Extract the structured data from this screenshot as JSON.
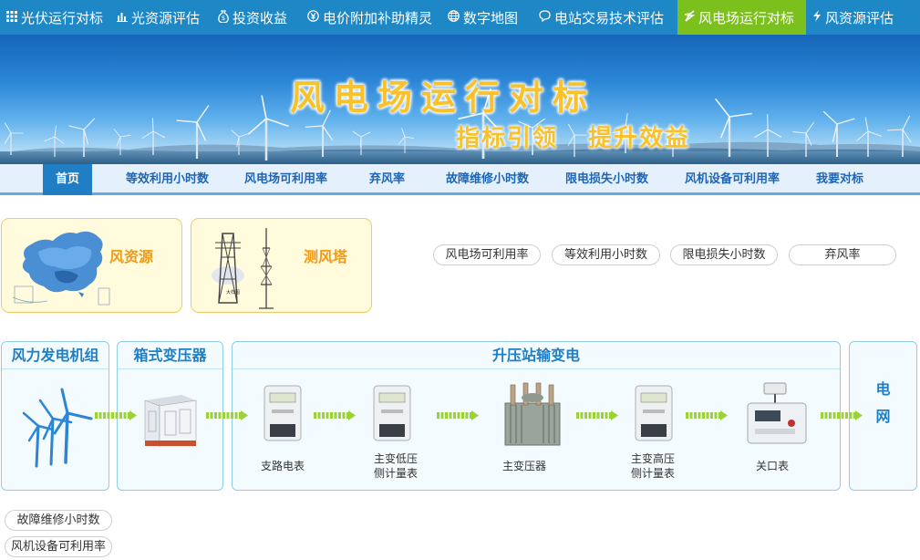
{
  "top_nav": [
    {
      "label": "光伏运行对标",
      "icon": "grid-icon",
      "active": false
    },
    {
      "label": "光资源评估",
      "icon": "bar-chart-icon",
      "active": false
    },
    {
      "label": "投资收益",
      "icon": "money-bag-icon",
      "active": false
    },
    {
      "label": "电价附加补助精灵",
      "icon": "yen-icon",
      "active": false
    },
    {
      "label": "数字地图",
      "icon": "globe-icon",
      "active": false
    },
    {
      "label": "电站交易技术评估",
      "icon": "chat-icon",
      "active": false
    },
    {
      "label": "风电场运行对标",
      "icon": "lightning-icon",
      "active": true
    },
    {
      "label": "风资源评估",
      "icon": "lightning-icon",
      "active": false
    }
  ],
  "banner": {
    "title": "风电场运行对标",
    "subtitle": "指标引领   提升效益"
  },
  "sub_nav": [
    {
      "label": "首页",
      "active": true
    },
    {
      "label": "等效利用小时数",
      "active": false
    },
    {
      "label": "风电场可利用率",
      "active": false
    },
    {
      "label": "弃风率",
      "active": false
    },
    {
      "label": "故障维修小时数",
      "active": false
    },
    {
      "label": "限电损失小时数",
      "active": false
    },
    {
      "label": "风机设备可利用率",
      "active": false
    },
    {
      "label": "我要对标",
      "active": false
    }
  ],
  "cards": [
    {
      "label": "风资源",
      "image": "china-map"
    },
    {
      "label": "测风塔",
      "image": "wind-tower"
    }
  ],
  "pills_top": [
    "风电场可利用率",
    "等效利用小时数",
    "限电损失小时数",
    "弃风率"
  ],
  "flow": {
    "box1_title": "风力发电机组",
    "box2_title": "箱式变压器",
    "box3_title": "升压站输变电",
    "grid_title": [
      "电",
      "网"
    ],
    "items": [
      "支路电表",
      "主变低压\n侧计量表",
      "主变压器",
      "主变高压\n侧计量表",
      "关口表"
    ]
  },
  "pills_bottom": [
    "故障维修小时数",
    "风机设备可利用率"
  ],
  "colors": {
    "top_nav_bg": "#1e88c7",
    "top_nav_active": "#7cc01e",
    "sub_nav_bg": "#e4f0fb",
    "sub_nav_active": "#1f7ec4",
    "card_bg": "#fffbdc",
    "card_label": "#f29a16",
    "flow_title": "#1e7fc6",
    "arrow": "#9dd13b"
  }
}
